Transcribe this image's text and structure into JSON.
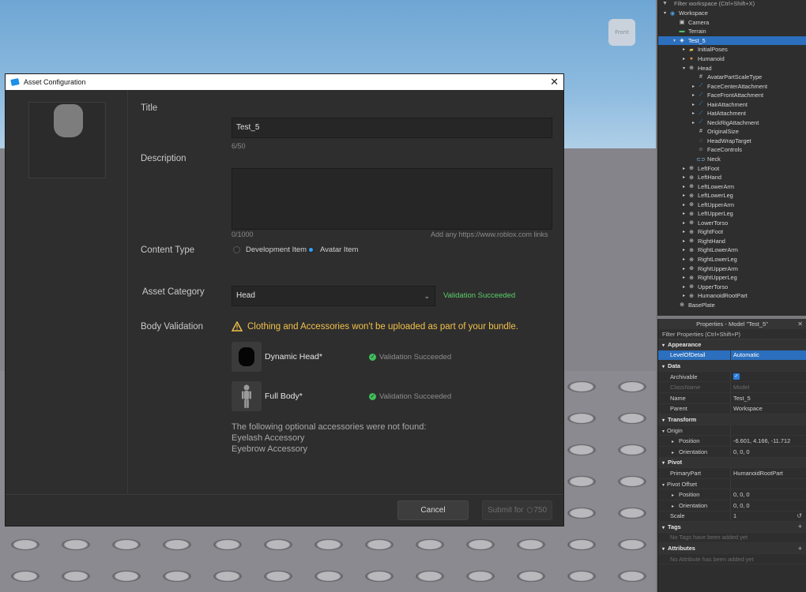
{
  "viewport": {
    "viewcube_label": "Front"
  },
  "dialog": {
    "title": "Asset Configuration",
    "labels": {
      "title": "Title",
      "description": "Description",
      "content_type": "Content Type",
      "asset_category": "Asset Category",
      "body_validation": "Body Validation"
    },
    "title_value": "Test_5",
    "title_count": "6/50",
    "description_count": "0/1000",
    "description_hint": "Add any https://www.roblox.com links",
    "content_type_options": [
      "Development Item",
      "Avatar Item"
    ],
    "content_type_selected": "Avatar Item",
    "asset_category_value": "Head",
    "category_status": "Validation Succeeded",
    "warning": "Clothing and Accessories won't be uploaded as part of your bundle.",
    "components": [
      {
        "name": "Dynamic Head*",
        "status": "Validation Succeeded"
      },
      {
        "name": "Full Body*",
        "status": "Validation Succeeded"
      }
    ],
    "optional_note": "The following optional accessories were not found:",
    "optional_missing": [
      "Eyelash Accessory",
      "Eyebrow Accessory"
    ],
    "cancel_label": "Cancel",
    "submit_label": "Submit for",
    "submit_price": "750"
  },
  "explorer": {
    "filter_placeholder": "Filter workspace (Ctrl+Shift+X)",
    "rows": [
      {
        "label": "Workspace",
        "icon": "globe-icon"
      },
      {
        "label": "Camera",
        "icon": "camera-icon"
      },
      {
        "label": "Terrain",
        "icon": "terrain-icon"
      },
      {
        "label": "Test_5",
        "icon": "model-icon"
      },
      {
        "label": "InitialPoses",
        "icon": "folder-icon"
      },
      {
        "label": "Humanoid",
        "icon": "humanoid-icon"
      },
      {
        "label": "Head",
        "icon": "part-icon"
      },
      {
        "label": "AvatarPartScaleType",
        "icon": "value-icon"
      },
      {
        "label": "FaceCenterAttachment",
        "icon": "attachment-icon"
      },
      {
        "label": "FaceFrontAttachment",
        "icon": "attachment-icon"
      },
      {
        "label": "HairAttachment",
        "icon": "attachment-icon"
      },
      {
        "label": "HatAttachment",
        "icon": "attachment-icon"
      },
      {
        "label": "NeckRigAttachment",
        "icon": "attachment-icon"
      },
      {
        "label": "OriginalSize",
        "icon": "value-icon"
      },
      {
        "label": "HeadWrapTarget",
        "icon": "wrap-icon"
      },
      {
        "label": "FaceControls",
        "icon": "face-icon"
      },
      {
        "label": "Neck",
        "icon": "motor-icon"
      },
      {
        "label": "LeftFoot",
        "icon": "part-icon"
      },
      {
        "label": "LeftHand",
        "icon": "part-icon"
      },
      {
        "label": "LeftLowerArm",
        "icon": "part-icon"
      },
      {
        "label": "LeftLowerLeg",
        "icon": "part-icon"
      },
      {
        "label": "LeftUpperArm",
        "icon": "part-icon"
      },
      {
        "label": "LeftUpperLeg",
        "icon": "part-icon"
      },
      {
        "label": "LowerTorso",
        "icon": "part-icon"
      },
      {
        "label": "RightFoot",
        "icon": "part-icon"
      },
      {
        "label": "RightHand",
        "icon": "part-icon"
      },
      {
        "label": "RightLowerArm",
        "icon": "part-icon"
      },
      {
        "label": "RightLowerLeg",
        "icon": "part-icon"
      },
      {
        "label": "RightUpperArm",
        "icon": "part-icon"
      },
      {
        "label": "RightUpperLeg",
        "icon": "part-icon"
      },
      {
        "label": "UpperTorso",
        "icon": "part-icon"
      },
      {
        "label": "HumanoidRootPart",
        "icon": "part-icon"
      },
      {
        "label": "BasePlate",
        "icon": "part-icon"
      }
    ]
  },
  "properties": {
    "title": "Properties - Model \"Test_5\"",
    "filter_placeholder": "Filter Properties (Ctrl+Shift+P)",
    "sections": {
      "appearance": "Appearance",
      "data": "Data",
      "transform": "Transform",
      "pivot": "Pivot",
      "tags": "Tags",
      "attributes": "Attributes"
    },
    "rows": {
      "level_of_detail": {
        "name": "LevelOfDetail",
        "value": "Automatic"
      },
      "archivable": {
        "name": "Archivable"
      },
      "class_name": {
        "name": "ClassName",
        "value": "Model"
      },
      "name": {
        "name": "Name",
        "value": "Test_5"
      },
      "parent": {
        "name": "Parent",
        "value": "Workspace"
      },
      "origin": {
        "name": "Origin"
      },
      "origin_position": {
        "name": "Position",
        "value": "-6.601, 4.166, -11.712"
      },
      "origin_orientation": {
        "name": "Orientation",
        "value": "0, 0, 0"
      },
      "primary_part": {
        "name": "PrimaryPart",
        "value": "HumanoidRootPart"
      },
      "pivot_offset": {
        "name": "Pivot Offset"
      },
      "pivot_position": {
        "name": "Position",
        "value": "0, 0, 0"
      },
      "pivot_orientation": {
        "name": "Orientation",
        "value": "0, 0, 0"
      },
      "scale": {
        "name": "Scale",
        "value": "1"
      }
    },
    "tags_empty": "No Tags have been added yet",
    "attributes_empty": "No Attribute has been added yet"
  }
}
